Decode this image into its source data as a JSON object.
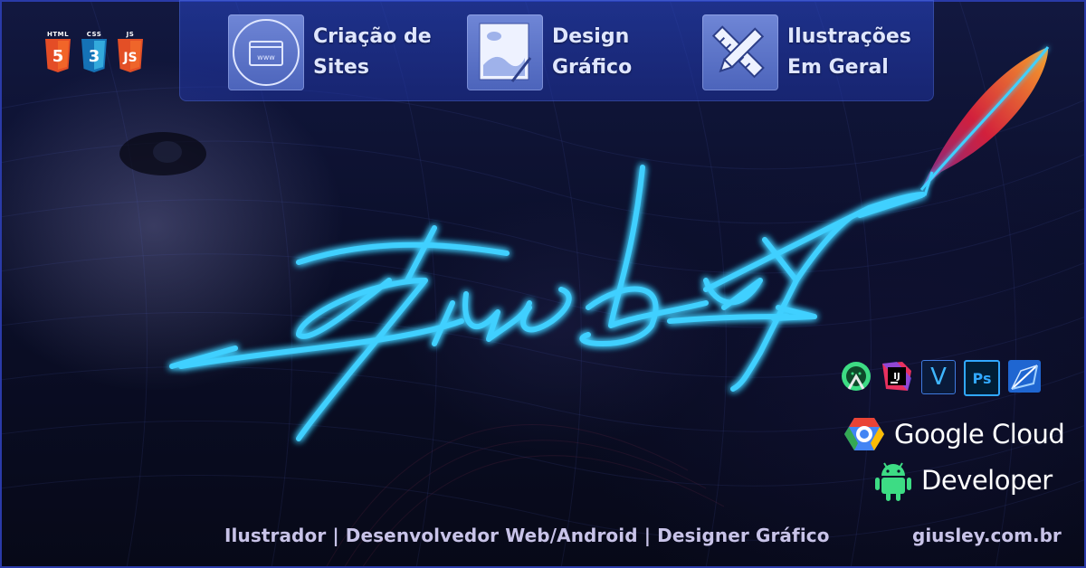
{
  "services": [
    {
      "icon": "browser-www-icon",
      "line1": "Criação de",
      "line2": "Sites",
      "icon_text": "www"
    },
    {
      "icon": "graphic-design-canvas-icon",
      "line1": "Design",
      "line2": "Gráfico"
    },
    {
      "icon": "pencil-ruler-icon",
      "line1": "Ilustrações",
      "line2": "Em Geral"
    }
  ],
  "web_badges": [
    {
      "tag": "HTML",
      "num": "5",
      "icon": "html5-icon",
      "color": "#e44d26"
    },
    {
      "tag": "CSS",
      "num": "3",
      "icon": "css3-icon",
      "color": "#1572b6"
    },
    {
      "tag": "JS",
      "num": "JS",
      "icon": "javascript-icon",
      "color": "#e34f26"
    }
  ],
  "tools": [
    {
      "icon": "android-studio-icon",
      "label": ""
    },
    {
      "icon": "intellij-idea-icon",
      "label": "IJ"
    },
    {
      "icon": "vectornator-icon",
      "label": "V"
    },
    {
      "icon": "photoshop-icon",
      "label": "Ps"
    },
    {
      "icon": "vector-app-icon",
      "label": ""
    }
  ],
  "google_cloud": {
    "label": "Google Cloud",
    "icon": "google-cloud-icon"
  },
  "google_developer": {
    "label": "Developer",
    "icon": "android-robot-icon"
  },
  "signature": {
    "icon": "giusley-signature-logo",
    "feather_icon": "apache-feather-icon"
  },
  "footer": {
    "tagline": "Ilustrador | Desenvolvedor Web/Android | Designer Gráfico",
    "url": "giusley.com.br"
  },
  "colors": {
    "neon": "#3fd0ff",
    "bar": "#2e4ec0",
    "text_light": "#dfe6ff",
    "footer_text": "#c8c3e8",
    "feather_red": "#d2203c",
    "feather_orange": "#f7a32b"
  }
}
